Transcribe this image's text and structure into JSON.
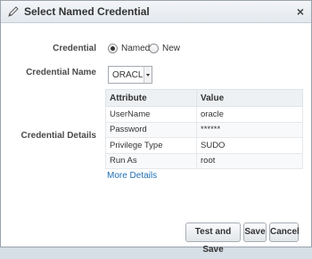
{
  "dialog": {
    "title": "Select Named Credential",
    "close_glyph": "×",
    "title_icon": "pencil-icon"
  },
  "form": {
    "credential_label": "Credential",
    "credential_options": [
      {
        "label": "Named",
        "checked": true
      },
      {
        "label": "New",
        "checked": false
      }
    ],
    "credential_name_label": "Credential Name",
    "credential_name_value": "ORACLE",
    "credential_details_label": "Credential Details"
  },
  "details_table": {
    "headers": [
      "Attribute",
      "Value"
    ],
    "rows": [
      [
        "UserName",
        "oracle"
      ],
      [
        "Password",
        "******"
      ],
      [
        "Privilege Type",
        "SUDO"
      ],
      [
        "Run As",
        "root"
      ]
    ]
  },
  "more_details_link": "More Details",
  "buttons": {
    "test_and_save": "Test and Save",
    "save": "Save",
    "cancel": "Cancel"
  }
}
